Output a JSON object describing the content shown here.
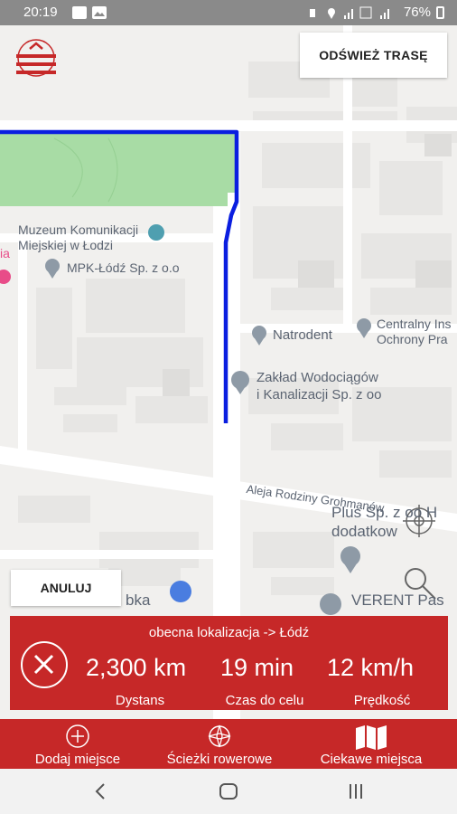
{
  "status_bar": {
    "time": "20:19",
    "battery": "76%"
  },
  "header": {
    "refresh_label": "ODŚWIEŻ TRASĘ"
  },
  "map": {
    "labels": {
      "museum_line1": "Muzeum Komunikacji",
      "museum_line2": "Miejskiej w Łodzi",
      "mpk": "MPK-Łódź Sp. z o.o",
      "natrodent": "Natrodent",
      "centralny_line1": "Centralny Ins",
      "centralny_line2": "Ochrony Pra",
      "zaklad_line1": "Zakład Wodociągów",
      "zaklad_line2": "i Kanalizacji Sp. z oo",
      "aleja": "Aleja Rodziny Grohmanów",
      "plus_line1": "Plus Sp. z oo H",
      "plus_line2": "dodatkow",
      "verent": "VERENT Pas",
      "biedronka": "bka",
      "left_edge": "ia"
    }
  },
  "cancel_label": "ANULUJ",
  "navigation": {
    "route": "obecna lokalizacja -> Łódź",
    "distance_value": "2,300 km",
    "distance_label": "Dystans",
    "time_value": "19 min",
    "time_label": "Czas do celu",
    "speed_value": "12 km/h",
    "speed_label": "Prędkość"
  },
  "bottom_nav": [
    {
      "label": "Dodaj miejsce",
      "icon": "add-place-icon"
    },
    {
      "label": "Ścieżki rowerowe",
      "icon": "compass-icon"
    },
    {
      "label": "Ciekawe miejsca",
      "icon": "map-icon"
    }
  ],
  "colors": {
    "accent": "#c62828",
    "route": "#0a1ee0",
    "park": "#a8dca5"
  }
}
